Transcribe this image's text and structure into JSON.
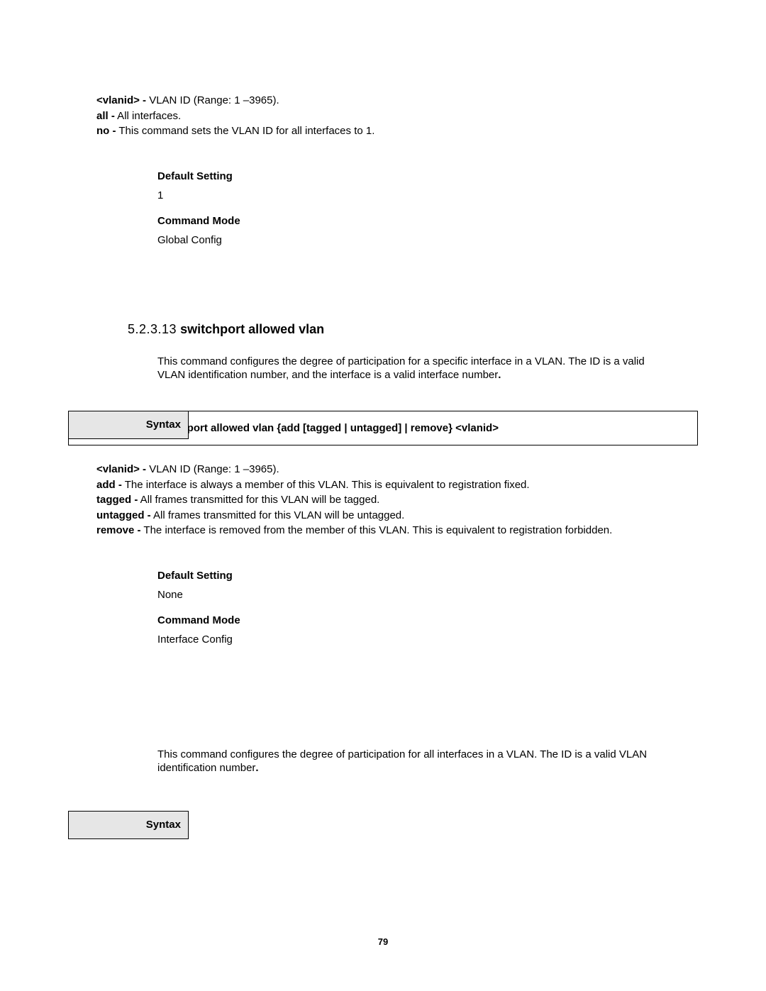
{
  "params_top": {
    "vlanid_label": "<vlanid> -",
    "vlanid_text": " VLAN ID (Range: 1 –3965).",
    "all_label": "all -",
    "all_text": " All interfaces.",
    "no_label": "no -",
    "no_text": " This command sets the VLAN ID for all interfaces to 1."
  },
  "block1": {
    "default_label": "Default Setting",
    "default_value": "1",
    "mode_label": "Command Mode",
    "mode_value": "Global Config"
  },
  "heading": {
    "num": "5.2.3.13",
    "title": " switchport allowed vlan"
  },
  "intro1": "This command configures the degree of participation for a specific interface in a VLAN. The ID is a valid VLAN identification number, and the interface is a valid interface number",
  "intro1_period": ".",
  "syntax_label": "Syntax",
  "syntax_body": "switchport allowed vlan {add [tagged | untagged] | remove} <vlanid>",
  "params_mid": {
    "vlanid_label": "<vlanid> -",
    "vlanid_text": " VLAN ID (Range: 1 –3965).",
    "add_label": "add -",
    "add_text": " The interface is always a member of this VLAN. This is equivalent to registration fixed.",
    "tagged_label": "tagged -",
    "tagged_text": " All frames transmitted for this VLAN will be tagged.",
    "untagged_label": "untagged -",
    "untagged_text": " All frames transmitted for this VLAN will be untagged.",
    "remove_label": "remove -",
    "remove_text": " The interface is removed from the member of this VLAN. This is equivalent to registration forbidden."
  },
  "block2": {
    "default_label": "Default Setting",
    "default_value": "None",
    "mode_label": "Command Mode",
    "mode_value": "Interface Config"
  },
  "intro2": "This command configures the degree of participation for all interfaces in a VLAN. The ID is a valid VLAN identification number",
  "intro2_period": ".",
  "page_number": "79"
}
